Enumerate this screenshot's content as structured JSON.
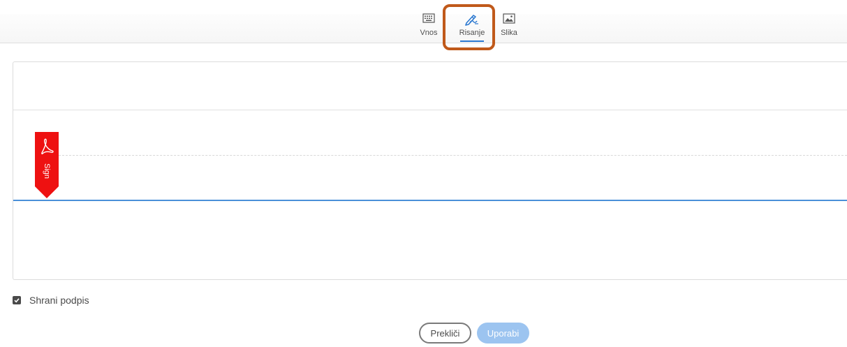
{
  "tabs": [
    {
      "label": "Vnos",
      "icon": "keyboard-icon",
      "selected": false
    },
    {
      "label": "Risanje",
      "icon": "draw-pen-icon",
      "selected": true
    },
    {
      "label": "Slika",
      "icon": "image-icon",
      "selected": false
    }
  ],
  "canvas": {
    "marker_label": "Sign",
    "marker_icon": "acrobat-sign-icon"
  },
  "save_signature": {
    "label": "Shrani podpis",
    "checked": true
  },
  "actions": {
    "cancel_label": "Prekliči",
    "use_label": "Uporabi",
    "use_enabled": false
  },
  "colors": {
    "accent": "#2b78d0",
    "highlight": "#c0591a",
    "marker": "#ee1111",
    "use_button_disabled": "#9cc4f0"
  }
}
